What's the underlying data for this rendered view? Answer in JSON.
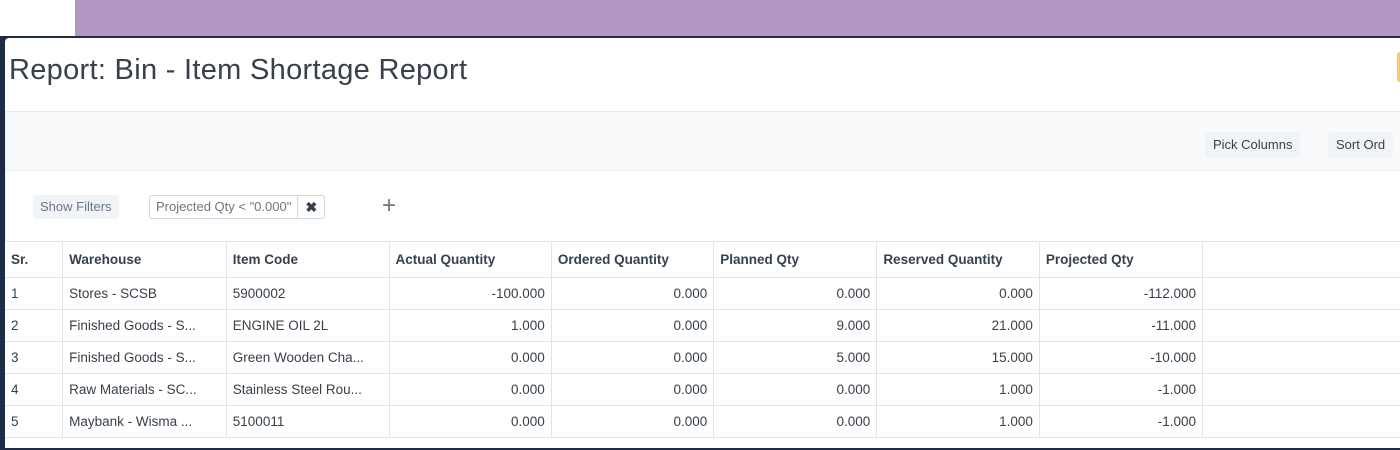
{
  "page": {
    "title": "Report: Bin - Item Shortage Report"
  },
  "toolbar": {
    "pick_columns": "Pick Columns",
    "sort_order": "Sort Ord"
  },
  "filters": {
    "show_filters": "Show Filters",
    "active_filter": "Projected Qty < \"0.000\"",
    "remove_icon": "close-icon",
    "add_icon": "plus-icon"
  },
  "table": {
    "columns": [
      "Sr.",
      "Warehouse",
      "Item Code",
      "Actual Quantity",
      "Ordered Quantity",
      "Planned Qty",
      "Reserved Quantity",
      "Projected Qty"
    ],
    "rows": [
      [
        "1",
        "Stores - SCSB",
        "5900002",
        "-100.000",
        "0.000",
        "0.000",
        "0.000",
        "-112.000"
      ],
      [
        "2",
        "Finished Goods - S...",
        "ENGINE OIL 2L",
        "1.000",
        "0.000",
        "9.000",
        "21.000",
        "-11.000"
      ],
      [
        "3",
        "Finished Goods - S...",
        "Green Wooden Cha...",
        "0.000",
        "0.000",
        "5.000",
        "15.000",
        "-10.000"
      ],
      [
        "4",
        "Raw Materials - SC...",
        "Stainless Steel Rou...",
        "0.000",
        "0.000",
        "0.000",
        "1.000",
        "-1.000"
      ],
      [
        "5",
        "Maybank - Wisma ...",
        "5100011",
        "0.000",
        "0.000",
        "0.000",
        "1.000",
        "-1.000"
      ]
    ]
  },
  "colors": {
    "header_band": "#b597c6",
    "frame": "#1e2b45",
    "text": "#36414c"
  }
}
